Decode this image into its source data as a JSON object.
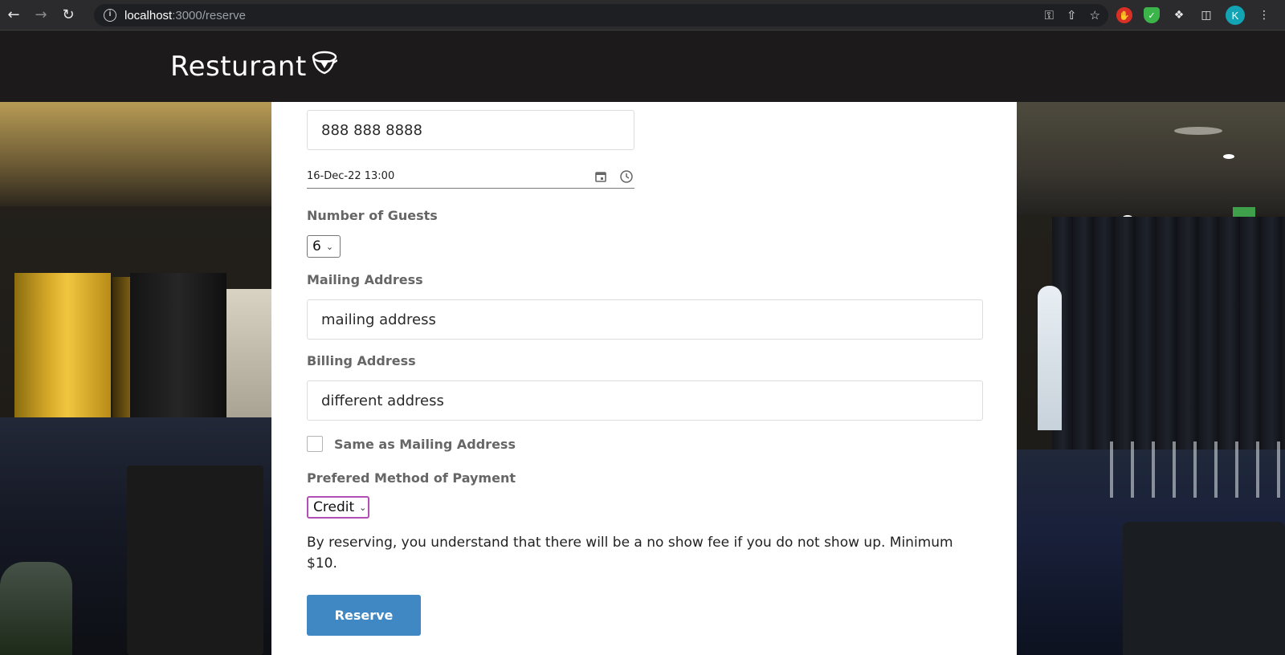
{
  "browser": {
    "url_host": "localhost",
    "url_path": ":3000/reserve",
    "profile_initial": "K",
    "icons": [
      "back-icon",
      "forward-icon",
      "reload-icon",
      "info-icon",
      "key-icon",
      "share-icon",
      "star-icon",
      "adblock-icon",
      "shield-icon",
      "puzzle-icon",
      "sidepanel-icon",
      "menu-icon"
    ]
  },
  "site": {
    "brand": "Resturant"
  },
  "form": {
    "phone_value": "888 888 8888",
    "datetime_value": "16-Dec-22 13:00",
    "guests_label": "Number of Guests",
    "guests_value": "6",
    "mailing_label": "Mailing Address",
    "mailing_value": "mailing address",
    "billing_label": "Billing Address",
    "billing_value": "different address",
    "same_as_label": "Same as Mailing Address",
    "same_as_checked": false,
    "payment_label": "Prefered Method of Payment",
    "payment_value": "Credit",
    "notice": "By reserving, you understand that there will be a no show fee if you do not show up. Minimum $10.",
    "reserve_label": "Reserve"
  },
  "colors": {
    "header_bg": "#1c1a1a",
    "button_bg": "#3f88c3",
    "select_focus": "#b04fb4"
  }
}
